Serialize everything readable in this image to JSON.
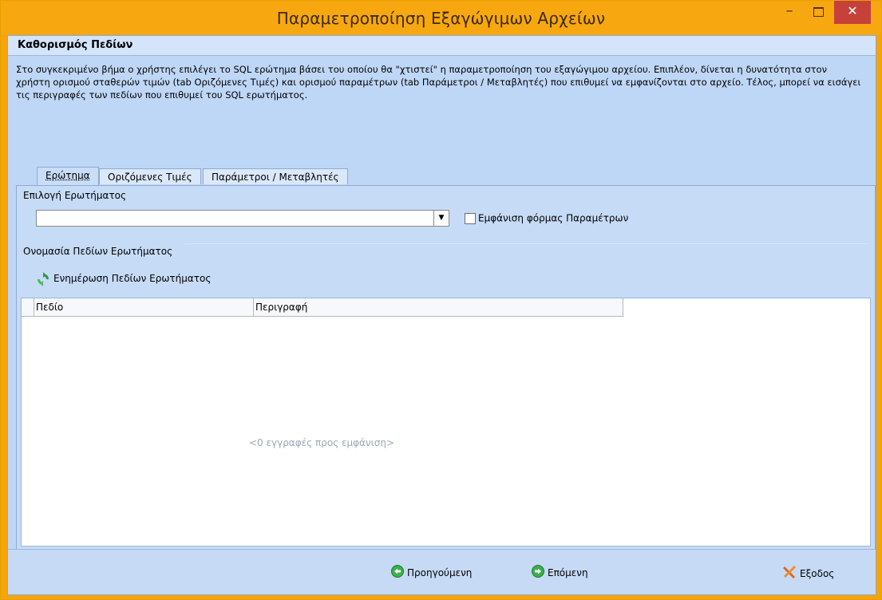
{
  "window": {
    "title": "Παραμετροποίηση Εξαγώγιμων Αρχείων",
    "min_glyph": "–",
    "close_glyph": "✕"
  },
  "section": {
    "title": "Καθορισμός Πεδίων",
    "description": "Στο συγκεκριμένο βήμα ο χρήστης επιλέγει το SQL ερώτημα βάσει του οποίου θα \"χτιστεί\" η παραμετροποίηση του εξαγώγιμου αρχείου. Επιπλέον, δίνεται η δυνατότητα στον χρήστη ορισμού σταθερών τιμών (tab Οριζόμενες Τιμές) και ορισμού παραμέτρων (tab Παράμετροι / Μεταβλητές) που επιθυμεί να εμφανίζονται στο αρχείο. Τέλος, μπορεί να εισάγει τις περιγραφές των πεδίων που επιθυμεί του SQL ερωτήματος."
  },
  "tabs": [
    {
      "label": "Ερώτημα"
    },
    {
      "label": "Οριζόμενες Τιμές"
    },
    {
      "label": "Παράμετροι / Μεταβλητές"
    }
  ],
  "query": {
    "select_label": "Επιλογή Ερωτήματος",
    "select_value": "",
    "dropdown_glyph": "▼",
    "show_params_label": "Εμφάνιση φόρμας Παραμέτρων",
    "fields_label": "Ονομασία Πεδίων Ερωτήματος",
    "refresh_label": "Ενημέρωση Πεδίων Ερωτήματος"
  },
  "grid": {
    "columns": [
      "Πεδίο",
      "Περιγραφή"
    ],
    "rows": [],
    "empty_text": "<0 εγγραφές προς εμφάνιση>"
  },
  "footer": {
    "prev_label": "Προηγούμενη",
    "next_label": "Επόμενη",
    "exit_label": "Εξοδος"
  },
  "colors": {
    "title_bar": "#f7a70f",
    "client_bg": "#bfd7f7",
    "close_button": "#c7413b",
    "nav_icon": "#3bb04a"
  },
  "icons": {
    "refresh": "refresh-icon",
    "prev": "arrow-left-circle-icon",
    "next": "arrow-right-circle-icon",
    "exit": "exit-x-icon"
  }
}
